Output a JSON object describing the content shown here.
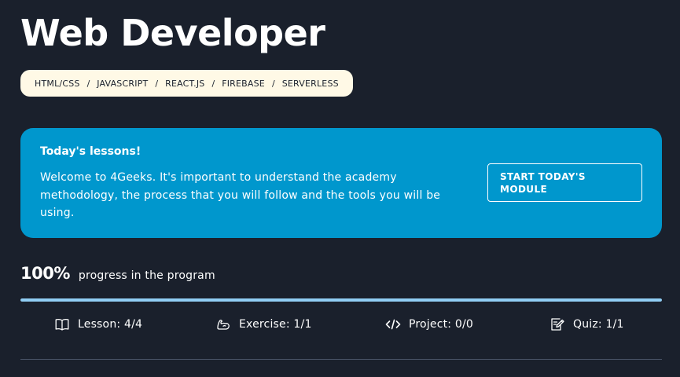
{
  "header": {
    "title": "Web Developer"
  },
  "breadcrumb": {
    "items": [
      "HTML/CSS",
      "JAVASCRIPT",
      "REACT.JS",
      "FIREBASE",
      "SERVERLESS"
    ],
    "separator": "/"
  },
  "lessons_card": {
    "heading": "Today's lessons!",
    "text": "Welcome to 4Geeks. It's important to understand the academy methodology, the process that you will follow and the tools you will be using.",
    "button_label": "START TODAY'S MODULE",
    "background_color": "#0097cd"
  },
  "progress": {
    "percent_label": "100%",
    "label": "progress in the program",
    "value": 100,
    "bar_color": "#90cdf4"
  },
  "stats": {
    "lesson": {
      "label": "Lesson: 4/4",
      "icon": "book-icon"
    },
    "exercise": {
      "label": "Exercise: 1/1",
      "icon": "strong-arm-icon"
    },
    "project": {
      "label": "Project: 0/0",
      "icon": "code-icon"
    },
    "quiz": {
      "label": "Quiz: 1/1",
      "icon": "edit-note-icon"
    }
  }
}
